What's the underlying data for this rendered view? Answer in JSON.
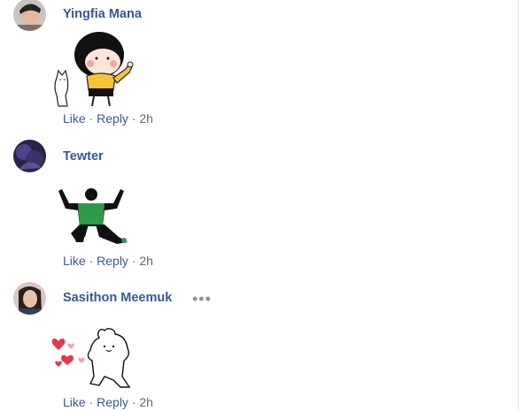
{
  "comments": [
    {
      "author": "Yingfia Mana",
      "sticker": "girl-thumbs-up-with-cat-sticker",
      "like": "Like",
      "reply": "Reply",
      "sep": "·",
      "time": "2h"
    },
    {
      "author": "Tewter",
      "sticker": "soccer-player-celebrating-sticker",
      "like": "Like",
      "reply": "Reply",
      "sep": "·",
      "time": "2h"
    },
    {
      "author": "Sasithon Meemuk",
      "sticker": "bunny-with-hearts-sticker",
      "like": "Like",
      "reply": "Reply",
      "sep": "·",
      "time": "2h",
      "more": "•••"
    }
  ],
  "colors": {
    "link": "#385898",
    "meta": "#606770",
    "jersey": "#2e9a4a",
    "heart": "#e8344e",
    "shirt": "#f7c23a"
  }
}
